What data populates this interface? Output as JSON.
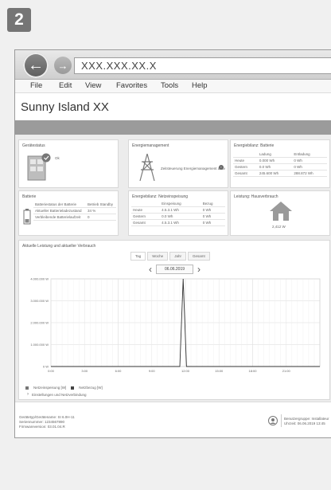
{
  "step_badge": "2",
  "browser": {
    "address": "XXX.XXX.XX.X",
    "menu": [
      "File",
      "Edit",
      "View",
      "Favorites",
      "Tools",
      "Help"
    ]
  },
  "app": {
    "title": "Sunny Island XX"
  },
  "panels": {
    "device_status": {
      "title": "Gerätestatus",
      "value": "Ok"
    },
    "energy_mgmt": {
      "title": "Energiemanagement",
      "note": "Zeitsteuerung Energiemanagement aktiv"
    },
    "battery_status": {
      "title": "Energiebilanz: Batterie",
      "headers": [
        "",
        "Ladung",
        "Entladung"
      ],
      "rows": [
        [
          "Heute",
          "0.000 Wh",
          "0 Wh"
        ],
        [
          "Gestern",
          "0.0 Wh",
          "0 Wh"
        ],
        [
          "Gesamt",
          "245.600 Wh",
          "288.872 Wh"
        ]
      ]
    },
    "battery": {
      "title": "Batterie",
      "rows": [
        [
          "Batteriestatus der Batterie",
          "Betrieb Standby"
        ],
        [
          "Aktueller Batterieladezustand",
          "34 %"
        ],
        [
          "Verbleibende Batterielaufzeit",
          "0"
        ]
      ]
    },
    "energy_source": {
      "title": "Energiebilanz: Netzeinspeisung",
      "headers": [
        "",
        "Einspeisung",
        "Bezug"
      ],
      "rows": [
        [
          "Heute",
          "4.5.3.1 Wh",
          "0 Wh"
        ],
        [
          "Gestern",
          "0.0 Wh",
          "0 Wh"
        ],
        [
          "Gesamt",
          "4.5.3.1 Wh",
          "0 Wh"
        ]
      ]
    },
    "house_load": {
      "title": "Leistung: Hausverbrauch",
      "value": "2,412 W"
    }
  },
  "chart_panel": {
    "title": "Aktuelle Leistung und aktueller Verbrauch",
    "tabs": [
      "Tag",
      "Woche",
      "Jahr",
      "Gesamt"
    ],
    "date": "06.06.2019",
    "legend": [
      "Netzeinspeisung [W]",
      "Netzbezug [W]"
    ],
    "collapsible": "Einstellungen und Netzverbindung"
  },
  "chart_data": {
    "type": "line",
    "y_tick_labels": [
      "4.000.000 W",
      "3.000.000 W",
      "2.000.000 W",
      "1.000.000 W",
      "0 W"
    ],
    "x_tick_labels": [
      "0:00",
      "3:00",
      "6:00",
      "9:00",
      "12:00",
      "15:00",
      "18:00",
      "21:00"
    ],
    "x": [
      0,
      11.5,
      11.8,
      12.1,
      24
    ],
    "y": [
      0,
      0,
      4000000,
      0,
      0
    ],
    "ylim": [
      0,
      4000000
    ],
    "xlim": [
      0,
      24
    ],
    "grid": true
  },
  "footer": {
    "left_lines": [
      "Gerätetyp/Gerätename: SI 6.0H-11",
      "Seriennummer: 1234567890",
      "Firmwareversion: 03.01.04.R"
    ],
    "right_lines": [
      "Benutzergruppe: Installateur",
      "Uhrzeit: 06.06.2019 13:45"
    ]
  },
  "colors": {
    "accent_dark_bar": "#9b9b9b",
    "line": "#333333",
    "house": "#9a9a9a"
  }
}
